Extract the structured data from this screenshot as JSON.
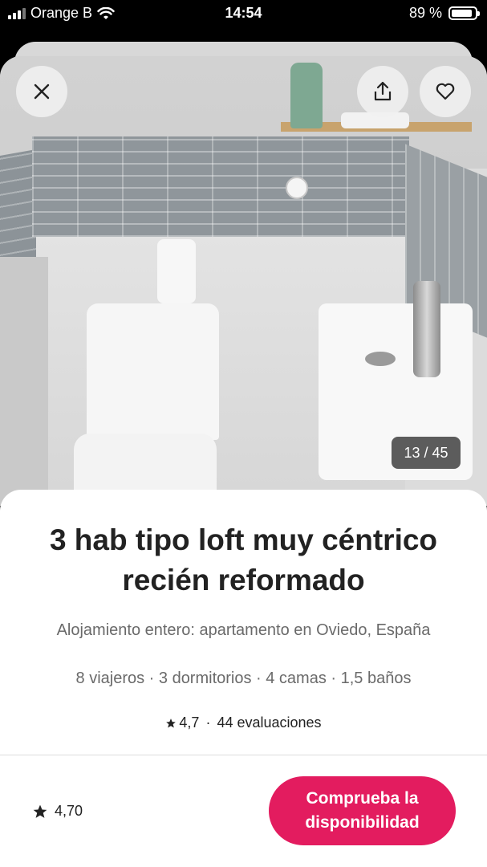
{
  "status_bar": {
    "carrier": "Orange B",
    "time": "14:54",
    "battery": "89 %",
    "battery_level": 0.89
  },
  "gallery": {
    "counter": "13 / 45",
    "current_photo": 13,
    "total_photos": 45
  },
  "listing": {
    "title": "3 hab  tipo loft muy céntrico recién reformado",
    "subtitle": "Alojamiento entero: apartamento en Oviedo, España",
    "specs": "8 viajeros · 3 dormitorios · 4 camas · 1,5 baños",
    "rating": "4,7",
    "separator": "·",
    "reviews": "44 evaluaciones"
  },
  "footer": {
    "rating": "4,70",
    "cta_label": "Comprueba la disponibilidad",
    "cta_color": "#e31c5f"
  },
  "icons": {
    "close": "close-icon",
    "share": "share-icon",
    "favorite": "heart-icon",
    "star": "star-icon"
  }
}
